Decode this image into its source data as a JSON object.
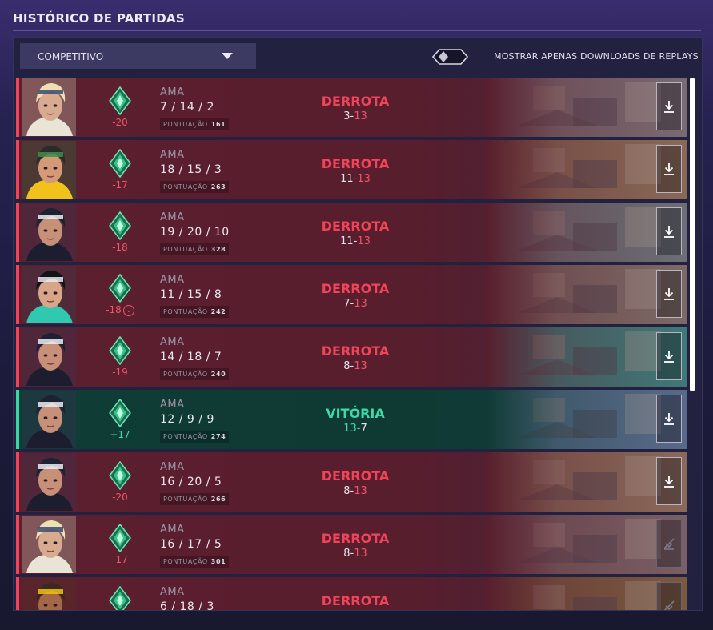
{
  "header": {
    "title": "HISTÓRICO DE PARTIDAS"
  },
  "filters": {
    "mode_selected": "COMPETITIVO",
    "toggle_label": "MOSTRAR APENAS DOWNLOADS DE REPLAYS",
    "toggle_on": false
  },
  "colors": {
    "loss": "#f14459",
    "win": "#39d7a4"
  },
  "matches": [
    {
      "agent_portrait": "sova-portrait",
      "rank_icon": "ascendant-rank-icon",
      "rr": "-20",
      "agent": "AMA",
      "kda": "7 / 14 / 2",
      "score_label": "PONTUAÇÃO",
      "score": "161",
      "result": "DERROTA",
      "score_a": "3",
      "score_sep": "-",
      "score_b": "13",
      "outcome": "loss",
      "replay": "download-icon"
    },
    {
      "agent_portrait": "killjoy-portrait",
      "rank_icon": "ascendant-rank-icon",
      "rr": "-17",
      "agent": "AMA",
      "kda": "18 / 15 / 3",
      "score_label": "PONTUAÇÃO",
      "score": "263",
      "result": "DERROTA",
      "score_a": "11",
      "score_sep": "-",
      "score_b": "13",
      "outcome": "loss",
      "replay": "download-icon"
    },
    {
      "agent_portrait": "neon-portrait",
      "rank_icon": "ascendant-rank-icon",
      "rr": "-18",
      "agent": "AMA",
      "kda": "19 / 20 / 10",
      "score_label": "PONTUAÇÃO",
      "score": "328",
      "result": "DERROTA",
      "score_a": "11",
      "score_sep": "-",
      "score_b": "13",
      "outcome": "loss",
      "replay": "download-icon"
    },
    {
      "agent_portrait": "sage-portrait",
      "rank_icon": "ascendant-rank-icon",
      "rr": "-18",
      "rr_badge": "⌄",
      "agent": "AMA",
      "kda": "11 / 15 / 8",
      "score_label": "PONTUAÇÃO",
      "score": "242",
      "result": "DERROTA",
      "score_a": "7",
      "score_sep": "-",
      "score_b": "13",
      "outcome": "loss",
      "replay": "download-icon"
    },
    {
      "agent_portrait": "neon-portrait",
      "rank_icon": "ascendant-rank-icon",
      "rr": "-19",
      "agent": "AMA",
      "kda": "14 / 18 / 7",
      "score_label": "PONTUAÇÃO",
      "score": "240",
      "result": "DERROTA",
      "score_a": "8",
      "score_sep": "-",
      "score_b": "13",
      "outcome": "loss",
      "replay": "download-icon"
    },
    {
      "agent_portrait": "neon-portrait",
      "rank_icon": "ascendant-rank-icon",
      "rr": "+17",
      "agent": "AMA",
      "kda": "12 / 9 / 9",
      "score_label": "PONTUAÇÃO",
      "score": "274",
      "result": "VITÓRIA",
      "score_a": "13",
      "score_sep": "-",
      "score_b": "7",
      "outcome": "win",
      "replay": "download-icon"
    },
    {
      "agent_portrait": "neon-portrait",
      "rank_icon": "ascendant-rank-icon",
      "rr": "-20",
      "agent": "AMA",
      "kda": "16 / 20 / 5",
      "score_label": "PONTUAÇÃO",
      "score": "266",
      "result": "DERROTA",
      "score_a": "8",
      "score_sep": "-",
      "score_b": "13",
      "outcome": "loss",
      "replay": "download-icon"
    },
    {
      "agent_portrait": "sova-portrait",
      "rank_icon": "ascendant-rank-icon",
      "rr": "-17",
      "agent": "AMA",
      "kda": "16 / 17 / 5",
      "score_label": "PONTUAÇÃO",
      "score": "301",
      "result": "DERROTA",
      "score_a": "8",
      "score_sep": "-",
      "score_b": "13",
      "outcome": "loss",
      "replay": "download-unavailable-icon"
    },
    {
      "agent_portrait": "raze-portrait",
      "rank_icon": "ascendant-rank-icon",
      "rr": "",
      "agent": "AMA",
      "kda": "6 / 18 / 3",
      "score_label": "",
      "score": "",
      "result": "DERROTA",
      "score_a": "",
      "score_sep": "",
      "score_b": "",
      "outcome": "loss",
      "replay": "download-unavailable-icon"
    }
  ]
}
